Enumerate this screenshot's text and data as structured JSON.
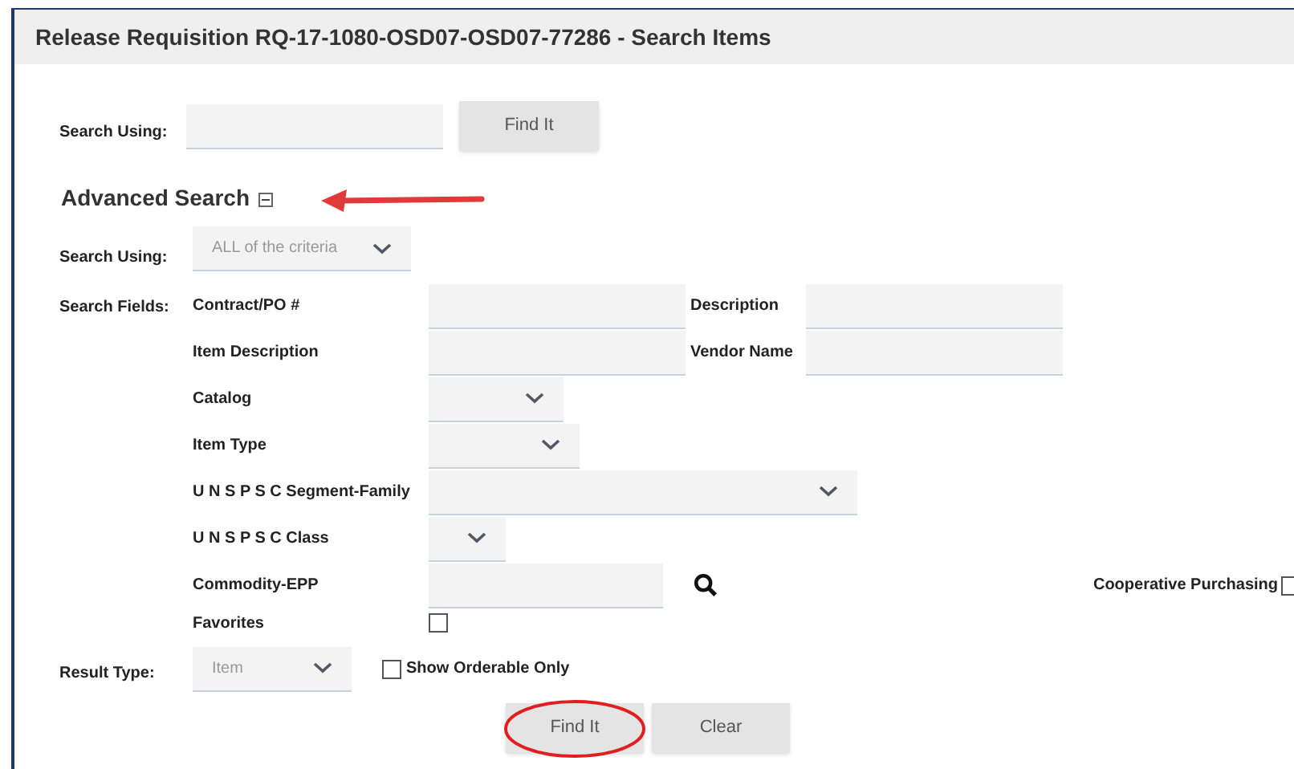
{
  "title": "Release Requisition RQ-17-1080-OSD07-OSD07-77286 - Search Items",
  "quick_search": {
    "label": "Search Using:",
    "button": "Find It"
  },
  "advanced": {
    "heading": "Advanced Search",
    "expanded": true,
    "search_using": {
      "label": "Search Using:",
      "value": "ALL of the criteria"
    },
    "fields_label": "Search Fields:",
    "fields": [
      {
        "kind": "text",
        "label": "Contract/PO #",
        "extra_label": "Description"
      },
      {
        "kind": "text",
        "label": "Item Description",
        "extra_label": "Vendor Name"
      },
      {
        "kind": "select",
        "label": "Catalog"
      },
      {
        "kind": "select",
        "label": "Item Type"
      },
      {
        "kind": "select",
        "label": "U N S P S C Segment-Family"
      },
      {
        "kind": "select",
        "label": "U N S P S C Class"
      },
      {
        "kind": "lookup",
        "label": "Commodity-EPP",
        "side_label": "Cooperative Purchasing",
        "side_checked": false
      },
      {
        "kind": "checkbox",
        "label": "Favorites",
        "checked": false
      }
    ],
    "result_type": {
      "label": "Result Type:",
      "value": "Item",
      "option_label": "Show Orderable Only",
      "option_checked": false
    },
    "buttons": [
      {
        "label": "Find It",
        "highlighted": true
      },
      {
        "label": "Clear",
        "highlighted": false
      }
    ]
  },
  "annotation_arrow": true
}
